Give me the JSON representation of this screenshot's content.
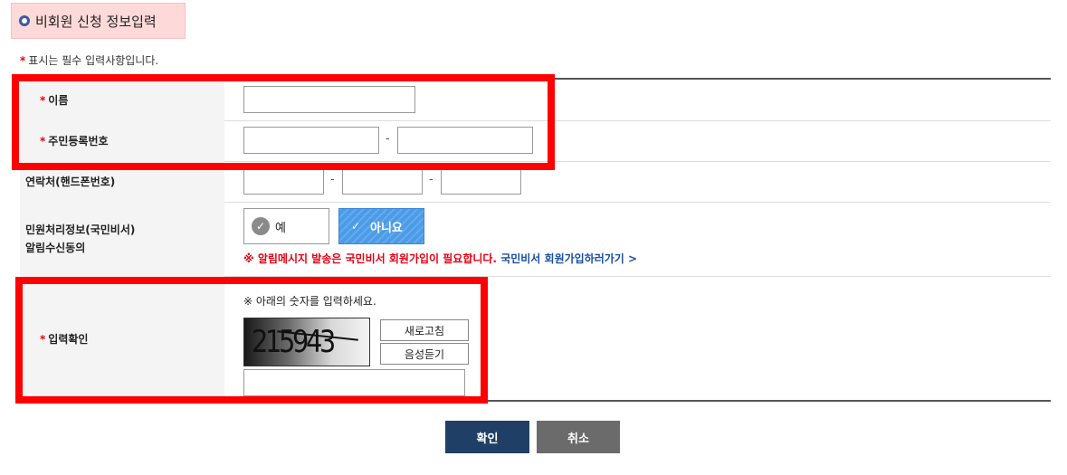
{
  "page": {
    "title": "비회원 신청 정보입력",
    "required_star": "*",
    "required_note": "표시는 필수 입력사항입니다."
  },
  "form": {
    "name_label": "이름",
    "rrn_label": "주민등록번호",
    "rrn_separator": "-",
    "phone_label": "연락처(핸드폰번호)",
    "phone_separator": "-",
    "consent_label_line1": "민원처리정보(국민비서)",
    "consent_label_line2": "알림수신동의",
    "consent_yes": "예",
    "consent_no": "아니요",
    "consent_selected": "아니요",
    "notice_text": "※ 알림메시지 발송은 국민비서 회원가입이 필요합니다.",
    "notice_link": "국민비서 회원가입하러가기 >",
    "captcha_label": "입력확인",
    "captcha_instruction": "※ 아래의 숫자를 입력하세요.",
    "captcha_code": "215943",
    "captcha_refresh": "새로고침",
    "captcha_audio": "음성듣기"
  },
  "buttons": {
    "confirm": "확인",
    "cancel": "취소"
  },
  "colors": {
    "accent_blue": "#4a9be8",
    "confirm_bg": "#1f3f66",
    "cancel_bg": "#6b6b6b",
    "highlight_red": "#ff0000",
    "title_bg": "#fdd9d9"
  }
}
